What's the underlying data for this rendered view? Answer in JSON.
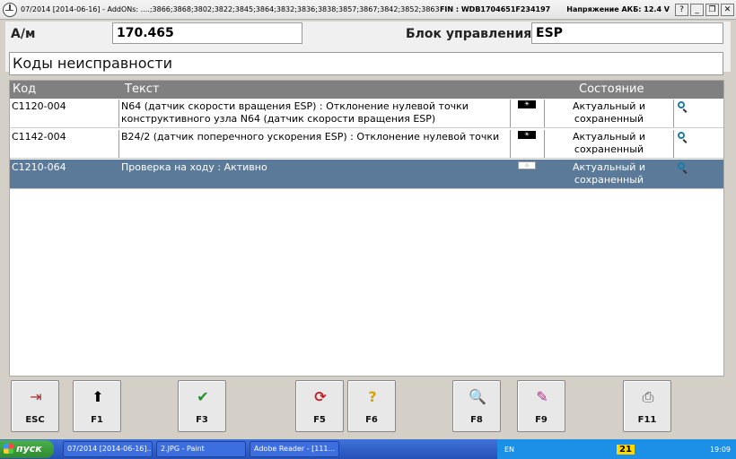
{
  "titlebar": {
    "title": "07/2014 [2014-06-16] - AddONs: ....;3866;3868;3802;3822;3845;3864;3832;3836;3838;3857;3867;3842;3852;3863",
    "fin": "FIN : WDB1704651F234197",
    "akb": "Напряжение АКБ: 12.4 V",
    "btn_help": "?",
    "btn_min": "_",
    "btn_restore": "❐",
    "btn_close": "✕"
  },
  "vehicle": {
    "label": "А/м",
    "value": "170.465"
  },
  "ecu": {
    "label": "Блок управления",
    "value": "ESP"
  },
  "section_title": "Коды неисправности",
  "table": {
    "headers": {
      "code": "Код",
      "text": "Текст",
      "state": "Состояние"
    },
    "rows": [
      {
        "code": "C1120-004",
        "text_line1": "N64 (датчик скорости вращения ESP) : Отклонение нулевой точки",
        "text_line2": "конструктивного узла N64 (датчик скорости вращения ESP)",
        "state_line1": "Актуальный и",
        "state_line2": "сохраненный",
        "flag": "☀"
      },
      {
        "code": "C1142-004",
        "text_line1": "B24/2 (датчик поперечного ускорения ESP) : Отклонение нулевой точки",
        "text_line2": "",
        "state_line1": "Актуальный и",
        "state_line2": "сохраненный",
        "flag": "☀"
      },
      {
        "code": "C1210-064",
        "text_line1": "Проверка на ходу : Активно",
        "text_line2": "",
        "state_line1": "Актуальный и",
        "state_line2": "сохраненный",
        "flag": "☼"
      }
    ]
  },
  "fkeys": [
    {
      "label": "ESC",
      "icon": "exit-door-icon",
      "glyph": "⇥"
    },
    {
      "label": "F1",
      "icon": "arrow-up-icon",
      "glyph": "⬆"
    },
    {
      "label": "F3",
      "icon": "checkmark-icon",
      "glyph": "✔"
    },
    {
      "label": "F5",
      "icon": "refresh-icon",
      "glyph": "⟳"
    },
    {
      "label": "F6",
      "icon": "help-icon",
      "glyph": "?"
    },
    {
      "label": "F8",
      "icon": "search-icon",
      "glyph": "🔍"
    },
    {
      "label": "F9",
      "icon": "edit-icon",
      "glyph": "✎"
    },
    {
      "label": "F11",
      "icon": "printer-icon",
      "glyph": "⎙"
    }
  ],
  "taskbar": {
    "start": "пуск",
    "tasks": [
      "07/2014 [2014-06-16]...",
      "2.JPG - Paint",
      "Adobe Reader - [111..."
    ],
    "lang": "EN",
    "badge": "21",
    "clock": "19:09"
  },
  "colors": {
    "selected_row": "#5b7a9a",
    "header_bg": "#808080",
    "taskbar": "#2451b8"
  }
}
